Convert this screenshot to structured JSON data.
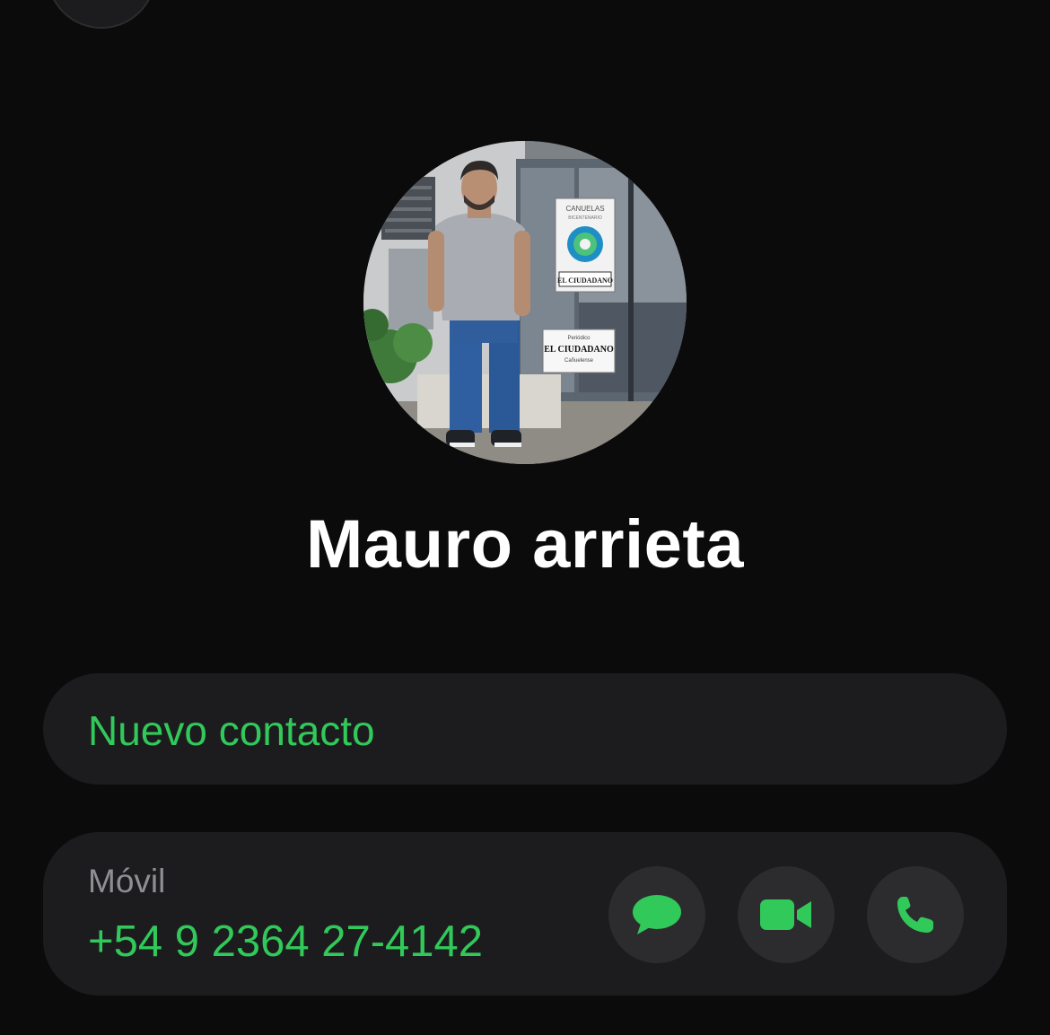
{
  "contact": {
    "name": "Mauro arrieta",
    "avatar_alt": "Profile photo of Mauro arrieta"
  },
  "actions": {
    "new_contact_label": "Nuevo contacto"
  },
  "phone": {
    "type_label": "Móvil",
    "number": "+54 9 2364 27-4142",
    "buttons": {
      "message_icon": "message-bubble-icon",
      "video_icon": "video-camera-icon",
      "call_icon": "phone-handset-icon"
    }
  },
  "colors": {
    "accent": "#31c95a",
    "background": "#0b0b0c",
    "card": "#1c1c1e",
    "button": "#2c2c2e",
    "secondary_text": "#8e8e93"
  },
  "avatar_photo": {
    "sign_top": "CANUELAS",
    "sign_sub": "BICENTENARIO",
    "sign_brand": "EL CIUDADANO",
    "sign_lower_top": "Periódico",
    "sign_lower_brand": "EL CIUDADANO",
    "sign_lower_sub": "Cañuelense"
  }
}
